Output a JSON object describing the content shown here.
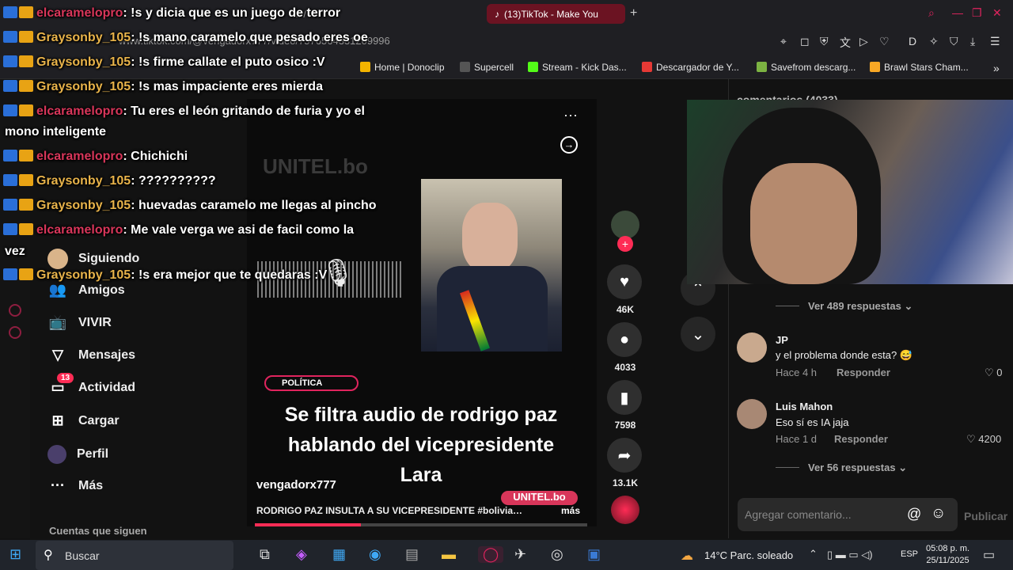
{
  "browser": {
    "tabs": [
      {
        "label": "... / X"
      },
      {
        "label": "(13)TikTok - Make You"
      }
    ],
    "url": "www.tiktok.com/@vengadorx777/video/7576564331209996",
    "bookmarks": [
      {
        "label": "Home | Donoclip",
        "color": "#f4b400"
      },
      {
        "label": "Supercell",
        "color": "#333333"
      },
      {
        "label": "Stream - Kick Das...",
        "color": "#53fc18"
      },
      {
        "label": "Descargador de Y...",
        "color": "#e53935"
      },
      {
        "label": "Savefrom descarg...",
        "color": "#7cb342"
      },
      {
        "label": "Brawl Stars Cham...",
        "color": "#f9a825"
      }
    ]
  },
  "sidebar": {
    "items": [
      {
        "icon": "user-circle",
        "label": "Siguiendo"
      },
      {
        "icon": "friends-icon",
        "label": "Amigos"
      },
      {
        "icon": "live-icon",
        "label": "VIVIR"
      },
      {
        "icon": "send-icon",
        "label": "Mensajes"
      },
      {
        "icon": "inbox-icon",
        "label": "Actividad",
        "badge": "13"
      },
      {
        "icon": "plus-square-icon",
        "label": "Cargar"
      },
      {
        "icon": "profile-icon",
        "label": "Perfil"
      },
      {
        "icon": "more-icon",
        "label": "Más"
      }
    ],
    "following_heading": "Cuentas que siguen"
  },
  "chat": [
    {
      "user": "elcaramelopro",
      "text": ": !s y dicia que es un juego de terror",
      "color": "u2"
    },
    {
      "user": "Graysonby_105",
      "text": ": !s mano caramelo que pesado eres oe",
      "color": "u1"
    },
    {
      "user": "Graysonby_105",
      "text": ": !s firme callate el puto osico :V",
      "color": "u1"
    },
    {
      "user": "Graysonby_105",
      "text": ": !s mas impaciente eres mierda",
      "color": "u1"
    },
    {
      "user": "elcaramelopro",
      "text": ": Tu eres el león gritando de furia y yo el",
      "color": "u2"
    },
    {
      "user": "",
      "text": "mono inteligente",
      "color": ""
    },
    {
      "user": "elcaramelopro",
      "text": ": Chichichi",
      "color": "u2"
    },
    {
      "user": "Graysonby_105",
      "text": ": ??????????",
      "color": "u1"
    },
    {
      "user": "Graysonby_105",
      "text": ": huevadas caramelo me llegas al pincho",
      "color": "u1"
    },
    {
      "user": "elcaramelopro",
      "text": ": Me vale verga we asi de facil como la",
      "color": "u2"
    },
    {
      "user": "",
      "text": "vez",
      "color": ""
    },
    {
      "user": "Graysonby_105",
      "text": ": !s era mejor que te quedaras :V",
      "color": "u1"
    }
  ],
  "video": {
    "watermark": "UNITEL.bo",
    "tag": "POLÍTICA",
    "headline_l1": "Se filtra audio de rodrigo paz",
    "headline_l2": "hablando del vicepresidente",
    "headline_l3": "Lara",
    "author": "vengadorx777",
    "caption": "RODRIGO PAZ INSULTA A SU VICEPRESIDENTE #bolivia…",
    "more": "más",
    "watermark2": "UNITEL.bo",
    "progress": 0.32
  },
  "actions": {
    "likes": "46K",
    "comments": "4033",
    "saves": "7598",
    "shares": "13.1K"
  },
  "comments_panel": {
    "header": "comentarios (4033)",
    "view_replies_1": "Ver 489 respuestas",
    "items": [
      {
        "name": "JP",
        "text": "y el problema donde esta? 😅",
        "time": "Hace 4 h",
        "reply": "Responder",
        "likes": "0"
      },
      {
        "name": "Luis Mahon",
        "text": "Eso sí es IA jaja",
        "time": "Hace 1 d",
        "reply": "Responder",
        "likes": "4200"
      }
    ],
    "view_replies_2": "Ver 56 respuestas",
    "input_placeholder": "Agregar comentario...",
    "publish": "Publicar"
  },
  "taskbar": {
    "search": "Buscar",
    "weather_temp": "14°C",
    "weather_text": "Parc. soleado",
    "lang": "ESP",
    "time": "05:08 p. m.",
    "date": "25/11/2025"
  }
}
